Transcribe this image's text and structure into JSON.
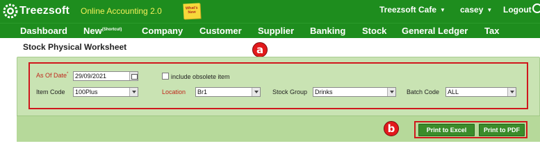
{
  "header": {
    "logo_text": "Treezsoft",
    "tagline": "Online Accounting 2.0",
    "whats_new": "What's New",
    "company": "Treezsoft Cafe",
    "user": "casey",
    "logout": "Logout"
  },
  "nav": {
    "items": [
      "Dashboard",
      "New",
      "Company",
      "Customer",
      "Supplier",
      "Banking",
      "Stock",
      "General Ledger",
      "Tax"
    ],
    "new_sup": "(Shortcut)"
  },
  "page": {
    "title": "Stock Physical Worksheet"
  },
  "form": {
    "as_of_date_label": "As Of Date",
    "as_of_date_required": "*",
    "as_of_date_value": "29/09/2021",
    "include_obsolete_label": "include obsolete item",
    "include_obsolete_checked": false,
    "item_code_label": "Item Code",
    "item_code_value": "100Plus",
    "location_label": "Location",
    "location_value": "Br1",
    "stock_group_label": "Stock Group",
    "stock_group_value": "Drinks",
    "batch_code_label": "Batch Code",
    "batch_code_value": "ALL"
  },
  "actions": {
    "print_excel": "Print to Excel",
    "print_pdf": "Print to PDF"
  },
  "markers": {
    "a": "a",
    "b": "b"
  },
  "colors": {
    "header_green": "#1e8d1e",
    "panel_green": "#c9e3b3",
    "button_green": "#3a8c2a",
    "highlight_red": "#d0161c",
    "tagline_yellow": "#f4f05a"
  }
}
